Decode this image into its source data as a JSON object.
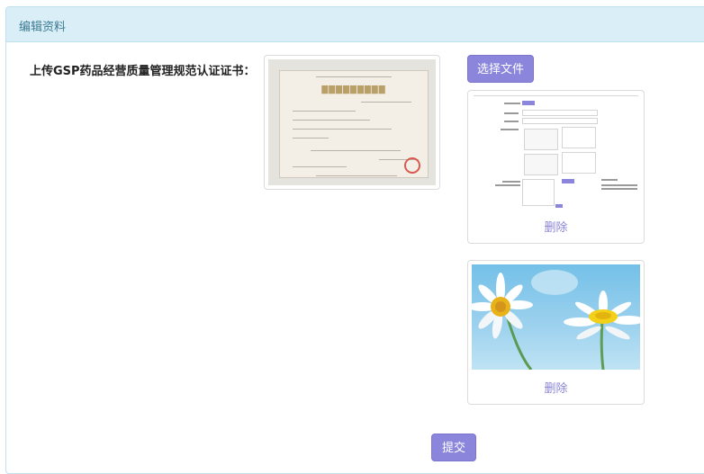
{
  "panel": {
    "title": "编辑资料"
  },
  "form": {
    "field_label": "上传GSP药品经营质量管理规范认证证书：",
    "choose_file_label": "选择文件",
    "submit_label": "提交",
    "uploaded": [
      {
        "delete_label": "删除"
      },
      {
        "delete_label": "删除"
      }
    ]
  },
  "colors": {
    "accent": "#8b86db",
    "heading_bg": "#d9eef6",
    "heading_text": "#3b7a93",
    "link": "#8a85d6"
  }
}
